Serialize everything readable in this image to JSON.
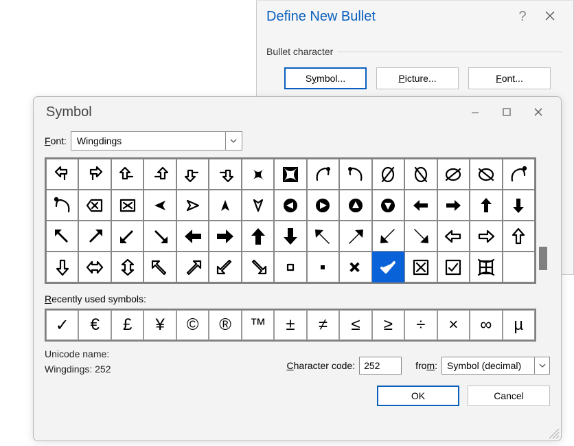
{
  "dnb": {
    "title": "Define New Bullet",
    "section": "Bullet character",
    "symbol_btn_pre": "S",
    "symbol_btn_und": "y",
    "symbol_btn_post": "mbol...",
    "picture_btn_pre": "",
    "picture_btn_und": "P",
    "picture_btn_post": "icture...",
    "font_btn_pre": "",
    "font_btn_und": "F",
    "font_btn_post": "ont..."
  },
  "sym": {
    "title": "Symbol",
    "font_label_pre": "",
    "font_label_und": "F",
    "font_label_post": "ont:",
    "font_value": "Wingdings",
    "recent_label_pre": "",
    "recent_label_und": "R",
    "recent_label_post": "ecently used symbols:",
    "unicode_name_label": "Unicode name:",
    "unicode_name_value": "Wingdings: 252",
    "cc_label_pre": "",
    "cc_label_und": "C",
    "cc_label_post": "haracter code:",
    "cc_value": "252",
    "from_label_pre": "fro",
    "from_label_und": "m",
    "from_label_post": ":",
    "from_value": "Symbol (decimal)",
    "ok": "OK",
    "cancel": "Cancel",
    "selected_index": 55
  },
  "recent": [
    "✓",
    "€",
    "£",
    "¥",
    "©",
    "®",
    "™",
    "±",
    "≠",
    "≤",
    "≥",
    "÷",
    "×",
    "∞",
    "µ"
  ]
}
